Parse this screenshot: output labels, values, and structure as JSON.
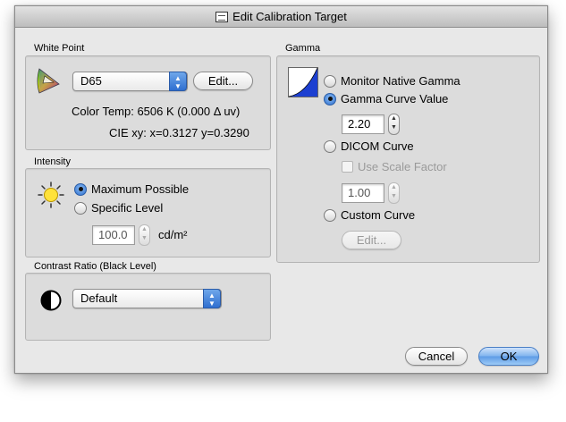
{
  "window": {
    "title": "Edit Calibration Target"
  },
  "white_point": {
    "group_label": "White Point",
    "selected": "D65",
    "edit_label": "Edit...",
    "color_temp": "Color Temp: 6506 K (0.000 Δ uv)",
    "cie": "CIE xy: x=0.3127 y=0.3290"
  },
  "intensity": {
    "group_label": "Intensity",
    "maximum": "Maximum Possible",
    "specific": "Specific Level",
    "value": "100.0",
    "unit": "cd/m²",
    "selected": "maximum"
  },
  "contrast": {
    "group_label": "Contrast Ratio (Black Level)",
    "selected": "Default"
  },
  "gamma": {
    "group_label": "Gamma",
    "native": "Monitor Native Gamma",
    "curve_value": "Gamma Curve Value",
    "curve_input": "2.20",
    "dicom": "DICOM Curve",
    "use_scale": "Use Scale Factor",
    "scale_input": "1.00",
    "custom": "Custom Curve",
    "custom_edit": "Edit...",
    "selected": "curve_value"
  },
  "footer": {
    "cancel": "Cancel",
    "ok": "OK"
  }
}
